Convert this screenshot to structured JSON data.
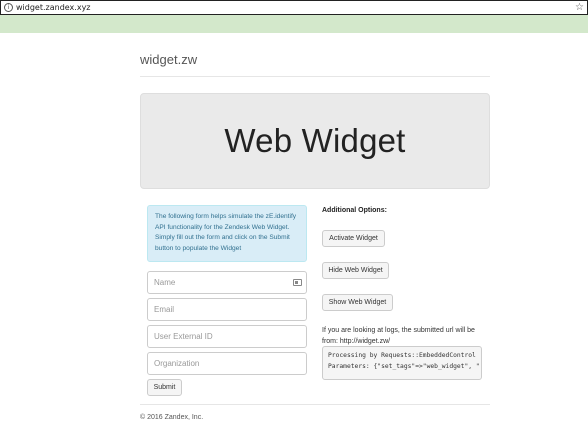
{
  "browser": {
    "url": "widget.zandex.xyz",
    "info_glyph": "i",
    "star_glyph": "☆"
  },
  "brand": "widget.zw",
  "jumbotron": {
    "title": "Web Widget"
  },
  "alert": {
    "text": "The following form helps simulate the zE.identify API functionality for the Zendesk Web Widget. Simply fill out the form and click on the Submit button to populate the Widget"
  },
  "form": {
    "name_placeholder": "Name",
    "email_placeholder": "Email",
    "external_id_placeholder": "User External ID",
    "organization_placeholder": "Organization",
    "submit_label": "Submit"
  },
  "options": {
    "title": "Additional Options:",
    "activate_label": "Activate Widget",
    "hide_label": "Hide Web Widget",
    "show_label": "Show Web Widget"
  },
  "logs": {
    "note": "If you are looking at logs, the submitted url will be from: http://widget.zw/",
    "line1": "Processing by Requests::EmbeddedControl",
    "line2": "Parameters: {\"set_tags\"=>\"web_widget\", \""
  },
  "footer": "© 2016 Zandex, Inc.",
  "colors": {
    "green_bar": "#d3e8cb",
    "alert_bg": "#d9edf7",
    "alert_text": "#31708f",
    "jumbotron_bg": "#eaeaea"
  }
}
